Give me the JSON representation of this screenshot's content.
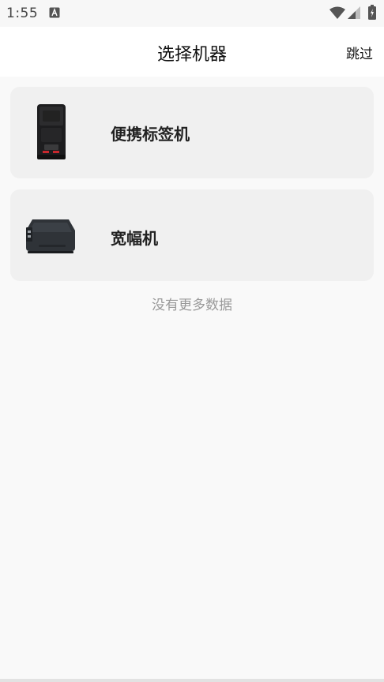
{
  "status_bar": {
    "time": "1:55",
    "icons": [
      "app-notification-icon",
      "wifi-icon",
      "cell-signal-icon",
      "battery-charging-icon"
    ]
  },
  "nav": {
    "title": "选择机器",
    "skip_label": "跳过"
  },
  "devices": [
    {
      "name": "便携标签机",
      "icon": "portable-label-printer-image"
    },
    {
      "name": "宽幅机",
      "icon": "wide-format-printer-image"
    }
  ],
  "list_footer": "没有更多数据",
  "colors": {
    "background": "#f9f9f9",
    "nav_background": "#ffffff",
    "card_background": "#f0f0f0",
    "footer_text": "#999999"
  }
}
